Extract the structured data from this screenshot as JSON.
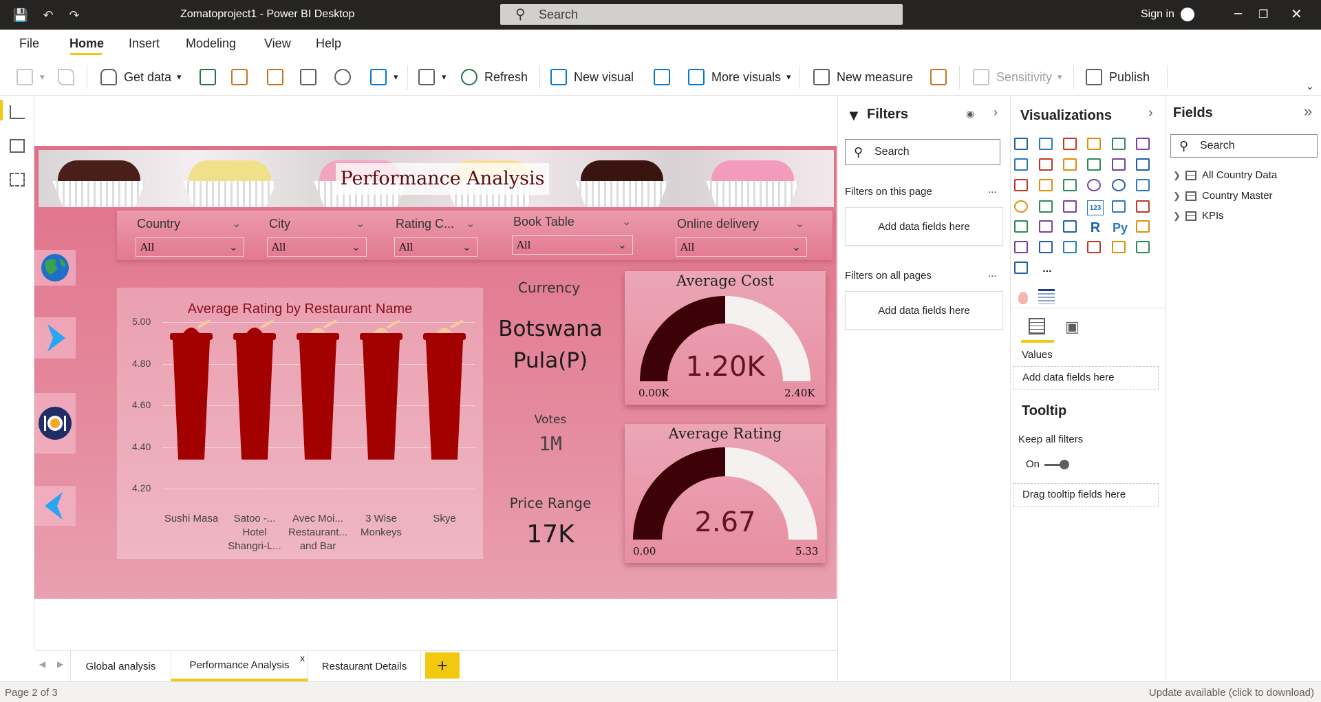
{
  "window": {
    "title": "Zomatoproject1 - Power BI Desktop",
    "search_placeholder": "Search",
    "sign_in": "Sign in"
  },
  "menu": [
    "File",
    "Home",
    "Insert",
    "Modeling",
    "View",
    "Help"
  ],
  "ribbon": {
    "get_data": "Get data",
    "refresh": "Refresh",
    "new_visual": "New visual",
    "more_visuals": "More visuals",
    "new_measure": "New measure",
    "sensitivity": "Sensitivity",
    "publish": "Publish"
  },
  "report": {
    "title": "Performance Analysis",
    "slicers": [
      {
        "label": "Country",
        "value": "All"
      },
      {
        "label": "City",
        "value": "All"
      },
      {
        "label": "Rating C...",
        "value": "All"
      },
      {
        "label": "Book Table",
        "value": "All"
      },
      {
        "label": "Online delivery",
        "value": "All"
      }
    ],
    "kpis": {
      "currency_label": "Currency",
      "currency_value_line1": "Botswana",
      "currency_value_line2": "Pula(P)",
      "votes_label": "Votes",
      "votes_value": "1M",
      "price_label": "Price Range",
      "price_value": "17K"
    },
    "gauges": [
      {
        "title": "Average Cost",
        "value_text": "1.20K",
        "min": "0.00K",
        "max": "2.40K",
        "fraction": 0.5
      },
      {
        "title": "Average Rating",
        "value_text": "2.67",
        "min": "0.00",
        "max": "5.33",
        "fraction": 0.5
      }
    ]
  },
  "chart_data": {
    "type": "bar",
    "title": "Average Rating by Restaurant Name",
    "categories": [
      "Sushi Masa",
      "Satoo -... Hotel Shangri-L...",
      "Avec Moi... Restaurant... and Bar",
      "3 Wise Monkeys",
      "Skye"
    ],
    "category_lines": [
      [
        "Sushi Masa"
      ],
      [
        "Satoo -...",
        "Hotel",
        "Shangri-L..."
      ],
      [
        "Avec Moi...",
        "Restaurant...",
        "and Bar"
      ],
      [
        "3 Wise",
        "Monkeys"
      ],
      [
        "Skye"
      ]
    ],
    "values": [
      4.9,
      4.9,
      4.9,
      4.9,
      4.9
    ],
    "yticks": [
      "5.00",
      "4.80",
      "4.60",
      "4.40",
      "4.20"
    ],
    "ylim": [
      4.2,
      5.0
    ],
    "xlabel": "",
    "ylabel": "",
    "colors": {
      "mark": "#a30000",
      "top": "#f3c9a0"
    }
  },
  "page_tabs": [
    {
      "label": "Global analysis",
      "active": false
    },
    {
      "label": "Performance Analysis",
      "active": true
    },
    {
      "label": "Restaurant Details",
      "active": false
    }
  ],
  "page_tab_close": "x",
  "add_tab": "+",
  "status": {
    "page": "Page 2 of 3",
    "update": "Update available (click to download)"
  },
  "filters_pane": {
    "title": "Filters",
    "search": "Search",
    "on_this_page": "Filters on this page",
    "on_all_pages": "Filters on all pages",
    "add_fields": "Add data fields here",
    "more": "..."
  },
  "viz_pane": {
    "title": "Visualizations",
    "values_label": "Values",
    "add_fields": "Add data fields here",
    "tooltip_title": "Tooltip",
    "keep_filters": "Keep all filters",
    "toggle": "On",
    "drag_tooltip": "Drag tooltip fields here",
    "r_label": "R",
    "py_label": "Py",
    "more_label": "...",
    "num_label": "123"
  },
  "fields_pane": {
    "title": "Fields",
    "search": "Search",
    "items": [
      "All Country Data",
      "Country Master",
      "KPIs"
    ]
  },
  "colors": {
    "accent": "#f2c811",
    "report_bg": "#e07088",
    "gauge_fill": "#3d0208",
    "gauge_empty": "#f5f1f1"
  }
}
